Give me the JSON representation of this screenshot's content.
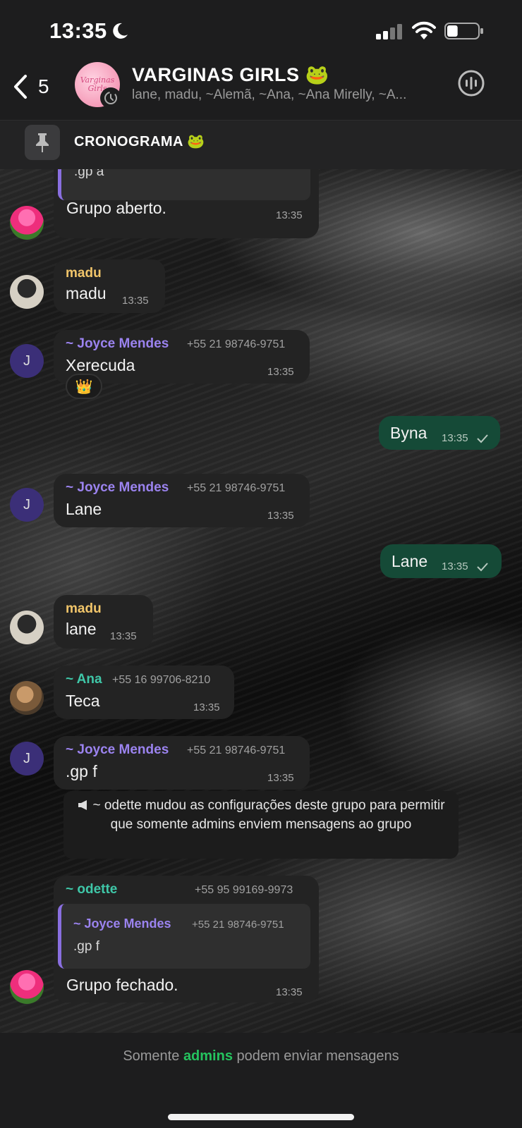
{
  "status": {
    "time": "13:35",
    "battery_percent": 35
  },
  "header": {
    "back_count": "5",
    "avatar_text": "Varginas Girls",
    "title": "VARGINAS GIRLS 🐸",
    "members": "lane, madu, ~Alemã, ~Ana, ~Ana Mirelly, ~A..."
  },
  "pinned": {
    "text": "CRONOGRAMA 🐸"
  },
  "messages": {
    "m1": {
      "quote_text": ".gp a",
      "text": "Grupo aberto.",
      "time": "13:35"
    },
    "m2": {
      "sender": "madu",
      "text": "madu",
      "time": "13:35"
    },
    "m3": {
      "sender": "~ Joyce Mendes",
      "phone": "+55 21 98746-9751",
      "text": "Xerecuda",
      "time": "13:35",
      "reaction": "👑",
      "avatar_letter": "J"
    },
    "m4": {
      "text": "Byna",
      "time": "13:35"
    },
    "m5": {
      "sender": "~ Joyce Mendes",
      "phone": "+55 21 98746-9751",
      "text": "Lane",
      "time": "13:35",
      "avatar_letter": "J"
    },
    "m6": {
      "text": "Lane",
      "time": "13:35"
    },
    "m7": {
      "sender": "madu",
      "text": "lane",
      "time": "13:35"
    },
    "m8": {
      "sender": "~ Ana",
      "phone": "+55 16 99706-8210",
      "text": "Teca",
      "time": "13:35"
    },
    "m9": {
      "sender": "~ Joyce Mendes",
      "phone": "+55 21 98746-9751",
      "text": ".gp f",
      "time": "13:35",
      "avatar_letter": "J"
    },
    "system": {
      "text": "~ odette mudou as configurações deste grupo para permitir que somente admins enviem mensagens ao grupo"
    },
    "m10": {
      "sender": "~ odette",
      "phone": "+55 95 99169-9973",
      "quote_sender": "~ Joyce Mendes",
      "quote_phone": "+55 21 98746-9751",
      "quote_text": ".gp f",
      "text": "Grupo fechado.",
      "time": "13:35"
    }
  },
  "footer": {
    "prefix": "Somente",
    "highlight": "admins",
    "suffix": "podem enviar mensagens"
  },
  "colors": {
    "joyce": "#9b83ef",
    "madu": "#f1c56a",
    "ana": "#3fc7a8",
    "odette": "#3fc7a8",
    "outgoing_bubble": "#154a37",
    "incoming_bubble": "#232323",
    "accent_green": "#25c35f"
  }
}
